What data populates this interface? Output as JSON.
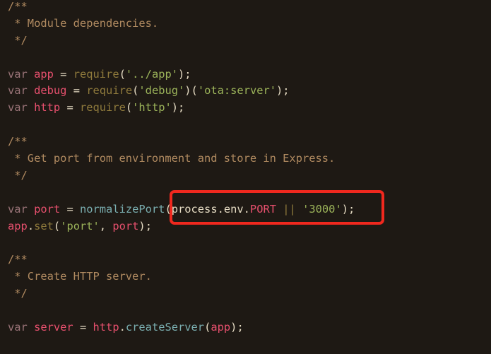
{
  "colors": {
    "background": "#1e1914",
    "comment": "#b08a60",
    "keyword": "#9a7478",
    "variable": "#e8506e",
    "builtin": "#8f7a3c",
    "string": "#9cb45a",
    "punct": "#e6dcc4",
    "function": "#7aaeb0",
    "highlight_box": "#f0281e"
  },
  "code_lines": [
    [
      {
        "t": "/**",
        "c": "comment"
      }
    ],
    [
      {
        "t": " * Module dependencies.",
        "c": "comment"
      }
    ],
    [
      {
        "t": " */",
        "c": "comment"
      }
    ],
    [],
    [
      {
        "t": "var",
        "c": "keyword"
      },
      {
        "t": " "
      },
      {
        "t": "app",
        "c": "variable"
      },
      {
        "t": " = ",
        "c": "punct"
      },
      {
        "t": "require",
        "c": "builtin"
      },
      {
        "t": "(",
        "c": "punct"
      },
      {
        "t": "'../app'",
        "c": "string"
      },
      {
        "t": ");",
        "c": "punct"
      }
    ],
    [
      {
        "t": "var",
        "c": "keyword"
      },
      {
        "t": " "
      },
      {
        "t": "debug",
        "c": "variable"
      },
      {
        "t": " = ",
        "c": "punct"
      },
      {
        "t": "require",
        "c": "builtin"
      },
      {
        "t": "(",
        "c": "punct"
      },
      {
        "t": "'debug'",
        "c": "string"
      },
      {
        "t": ")(",
        "c": "punct"
      },
      {
        "t": "'ota:server'",
        "c": "string"
      },
      {
        "t": ");",
        "c": "punct"
      }
    ],
    [
      {
        "t": "var",
        "c": "keyword"
      },
      {
        "t": " "
      },
      {
        "t": "http",
        "c": "variable"
      },
      {
        "t": " = ",
        "c": "punct"
      },
      {
        "t": "require",
        "c": "builtin"
      },
      {
        "t": "(",
        "c": "punct"
      },
      {
        "t": "'http'",
        "c": "string"
      },
      {
        "t": ");",
        "c": "punct"
      }
    ],
    [],
    [
      {
        "t": "/**",
        "c": "comment"
      }
    ],
    [
      {
        "t": " * Get port from environment and store in Express.",
        "c": "comment"
      }
    ],
    [
      {
        "t": " */",
        "c": "comment"
      }
    ],
    [],
    [
      {
        "t": "var",
        "c": "keyword"
      },
      {
        "t": " "
      },
      {
        "t": "port",
        "c": "variable"
      },
      {
        "t": " = ",
        "c": "punct"
      },
      {
        "t": "normalizePort",
        "c": "function"
      },
      {
        "t": "(process.env.",
        "c": "punct"
      },
      {
        "t": "PORT",
        "c": "variable"
      },
      {
        "t": " ",
        "c": "punct"
      },
      {
        "t": "||",
        "c": "builtin"
      },
      {
        "t": " ",
        "c": "punct"
      },
      {
        "t": "'3000'",
        "c": "string"
      },
      {
        "t": ");",
        "c": "punct"
      }
    ],
    [
      {
        "t": "app",
        "c": "variable"
      },
      {
        "t": ".",
        "c": "punct"
      },
      {
        "t": "set",
        "c": "builtin"
      },
      {
        "t": "(",
        "c": "punct"
      },
      {
        "t": "'port'",
        "c": "string"
      },
      {
        "t": ", ",
        "c": "punct"
      },
      {
        "t": "port",
        "c": "variable"
      },
      {
        "t": ");",
        "c": "punct"
      }
    ],
    [],
    [
      {
        "t": "/**",
        "c": "comment"
      }
    ],
    [
      {
        "t": " * Create HTTP server.",
        "c": "comment"
      }
    ],
    [
      {
        "t": " */",
        "c": "comment"
      }
    ],
    [],
    [
      {
        "t": "var",
        "c": "keyword"
      },
      {
        "t": " "
      },
      {
        "t": "server",
        "c": "variable"
      },
      {
        "t": " = ",
        "c": "punct"
      },
      {
        "t": "http",
        "c": "variable"
      },
      {
        "t": ".",
        "c": "punct"
      },
      {
        "t": "createServer",
        "c": "function"
      },
      {
        "t": "(",
        "c": "punct"
      },
      {
        "t": "app",
        "c": "variable"
      },
      {
        "t": ");",
        "c": "punct"
      }
    ]
  ]
}
